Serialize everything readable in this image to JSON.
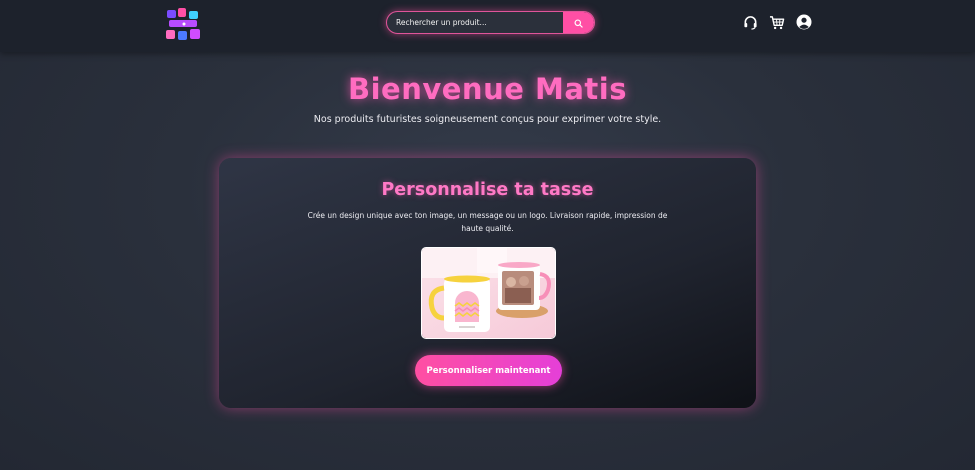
{
  "header": {
    "logo_icon": "mug-shop-logo-icon",
    "search": {
      "placeholder": "Rechercher un produit...",
      "value": "",
      "button_icon": "search-icon"
    },
    "icons": [
      "headset-icon",
      "cart-icon",
      "user-icon"
    ]
  },
  "hero": {
    "title": "Bienvenue Matis",
    "subtitle": "Nos produits futuristes soigneusement conçus pour exprimer votre style."
  },
  "card": {
    "title": "Personnalise ta tasse",
    "description": "Crée un design unique avec ton image, un message ou un logo. Livraison rapide, impression de haute qualité.",
    "image_icon": "mug-photo-icon",
    "button_label": "Personnaliser maintenant"
  },
  "colors": {
    "accent": "#ff4fa5",
    "title_pink": "#ff6cc0",
    "navbar": "#1d222c",
    "background": "#2a303c"
  }
}
